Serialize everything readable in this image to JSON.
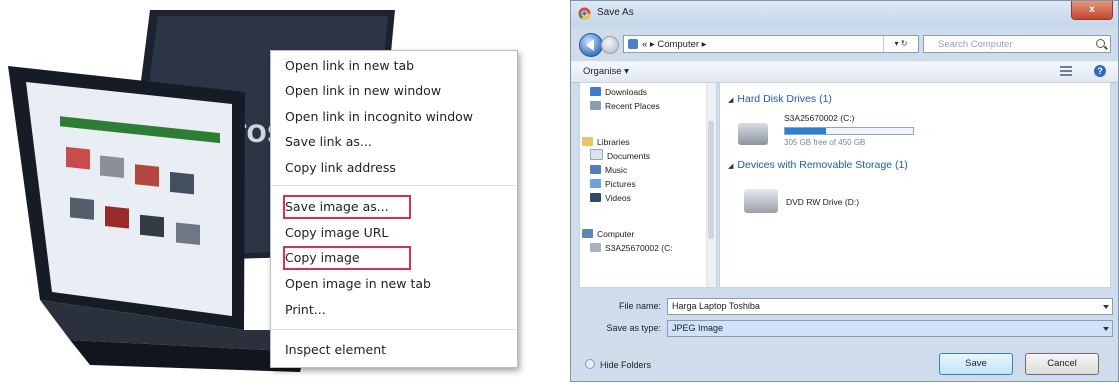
{
  "context_menu": {
    "items": [
      {
        "label": "Open link in new tab"
      },
      {
        "label": "Open link in new window"
      },
      {
        "label": "Open link in incognito window"
      },
      {
        "label": "Save link as..."
      },
      {
        "label": "Copy link address"
      },
      {
        "label": "Save image as...",
        "highlighted": true
      },
      {
        "label": "Copy image URL"
      },
      {
        "label": "Copy image",
        "highlighted": true
      },
      {
        "label": "Open image in new tab"
      },
      {
        "label": "Print..."
      },
      {
        "label": "Inspect element"
      }
    ],
    "highlight_color": "#d3344a"
  },
  "laptop": {
    "brand_text": "TOS"
  },
  "save_dialog": {
    "title": "Save As",
    "close_label": "x",
    "breadcrumb": "« ▸ Computer ▸",
    "search_placeholder": "Search Computer",
    "organise_label": "Organise ▾",
    "nav_items": [
      {
        "label": "Downloads",
        "icon": "downloads-icon"
      },
      {
        "label": "Recent Places",
        "icon": "recent-places-icon"
      },
      {
        "label": "Libraries",
        "icon": "libraries-icon"
      },
      {
        "label": "Documents",
        "icon": "documents-icon"
      },
      {
        "label": "Music",
        "icon": "music-icon"
      },
      {
        "label": "Pictures",
        "icon": "pictures-icon"
      },
      {
        "label": "Videos",
        "icon": "videos-icon"
      },
      {
        "label": "Computer",
        "icon": "computer-icon"
      },
      {
        "label": "S3A25670002 (C:",
        "icon": "drive-icon"
      }
    ],
    "groups": {
      "hard_disks": "Hard Disk Drives (1)",
      "removable": "Devices with Removable Storage (1)"
    },
    "drives": {
      "c_name": "S3A25670002 (C:)",
      "c_free": "305 GB free of 450 GB",
      "c_used_fraction": 0.32,
      "dvd_name": "DVD RW Drive (D:)"
    },
    "file_name_label": "File name:",
    "file_name_value": "Harga Laptop Toshiba",
    "save_type_label": "Save as type:",
    "save_type_value": "JPEG Image",
    "hide_folders_label": "Hide Folders",
    "save_button": "Save",
    "cancel_button": "Cancel"
  }
}
